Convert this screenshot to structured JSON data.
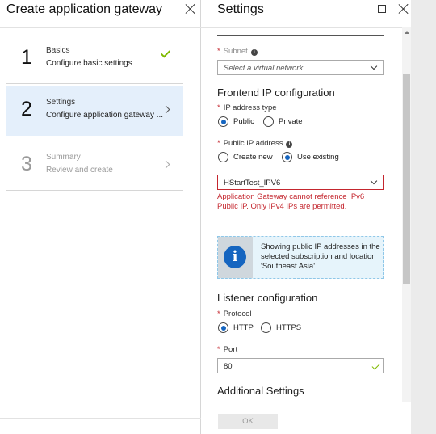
{
  "left_blade": {
    "title": "Create application gateway",
    "steps": [
      {
        "number": "1",
        "title": "Basics",
        "subtitle": "Configure basic settings",
        "status": "completed"
      },
      {
        "number": "2",
        "title": "Settings",
        "subtitle": "Configure application gateway ...",
        "status": "active"
      },
      {
        "number": "3",
        "title": "Summary",
        "subtitle": "Review and create",
        "status": "disabled"
      }
    ]
  },
  "right_blade": {
    "title": "Settings",
    "subnet": {
      "label": "Subnet",
      "placeholder": "Select a virtual network"
    },
    "frontend": {
      "section_title": "Frontend IP configuration",
      "ip_type_label": "IP address type",
      "ip_type_options": [
        "Public",
        "Private"
      ],
      "ip_type_selected": "Public",
      "public_ip_label": "Public IP address",
      "public_ip_options": [
        "Create new",
        "Use existing"
      ],
      "public_ip_selected": "Use existing",
      "public_ip_value": "HStartTest_IPV6",
      "error_message": "Application Gateway cannot reference IPv6 Public IP. Only IPv4 IPs are permitted.",
      "info_message": "Showing public IP addresses in the selected subscription and location 'Southeast Asia'."
    },
    "listener": {
      "section_title": "Listener configuration",
      "protocol_label": "Protocol",
      "protocol_options": [
        "HTTP",
        "HTTPS"
      ],
      "protocol_selected": "HTTP",
      "port_label": "Port",
      "port_value": "80"
    },
    "additional": {
      "section_title": "Additional Settings"
    },
    "footer": {
      "ok_label": "OK"
    }
  },
  "colors": {
    "accent": "#1565c0",
    "error": "#c4262e",
    "success": "#7fba00",
    "active_step_bg": "#e4effb",
    "info_bg": "#e6f4fb"
  }
}
